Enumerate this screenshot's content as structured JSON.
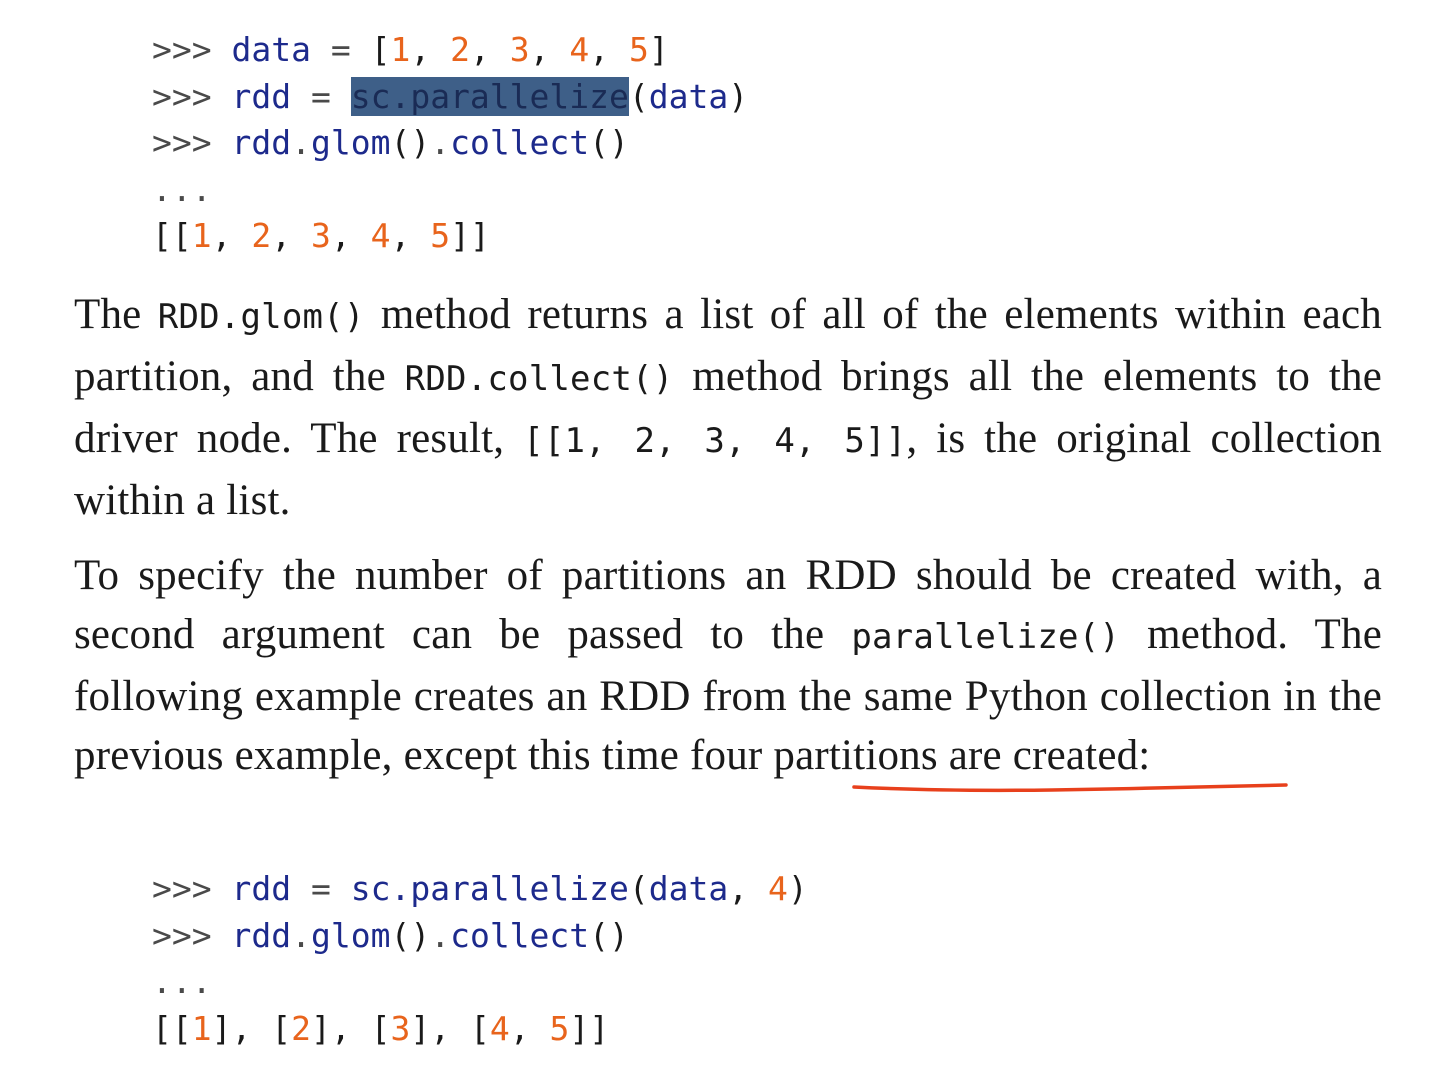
{
  "code_block_1": {
    "prompt": ">>>",
    "line1": {
      "var": "data",
      "assign": "=",
      "items": [
        "1",
        "2",
        "3",
        "4",
        "5"
      ]
    },
    "line2": {
      "var": "rdd",
      "assign": "=",
      "call": "sc.parallelize",
      "arg": "data"
    },
    "line3": {
      "obj": "rdd",
      "m1": "glom",
      "m2": "collect"
    },
    "ellipsis": "...",
    "output": [
      "1",
      "2",
      "3",
      "4",
      "5"
    ]
  },
  "paragraph_1": {
    "t1": "The ",
    "c1": "RDD.glom()",
    "t2": " method returns a list of all of the elements within each partition, and the ",
    "c2": "RDD.collect()",
    "t3": " method brings all the elements to the driver node. The result, ",
    "c3": "[[1, 2, 3, 4, 5]]",
    "t4": ", is the original collection within a list."
  },
  "paragraph_2": {
    "t1": "To specify the number of partitions an RDD should be created with, a second argument can be passed to the ",
    "c1": "parallelize()",
    "t2": " method. The following example creates an RDD from the same Python collection in the previous example, except this time four partitions are created:"
  },
  "code_block_2": {
    "prompt": ">>>",
    "line1": {
      "var": "rdd",
      "assign": "=",
      "call": "sc.parallelize",
      "arg": "data",
      "num": "4"
    },
    "line2": {
      "obj": "rdd",
      "m1": "glom",
      "m2": "collect"
    },
    "ellipsis": "...",
    "output": [
      "1",
      "2",
      "3",
      "4",
      "5"
    ]
  },
  "annotation": {
    "color": "#e8401c"
  }
}
